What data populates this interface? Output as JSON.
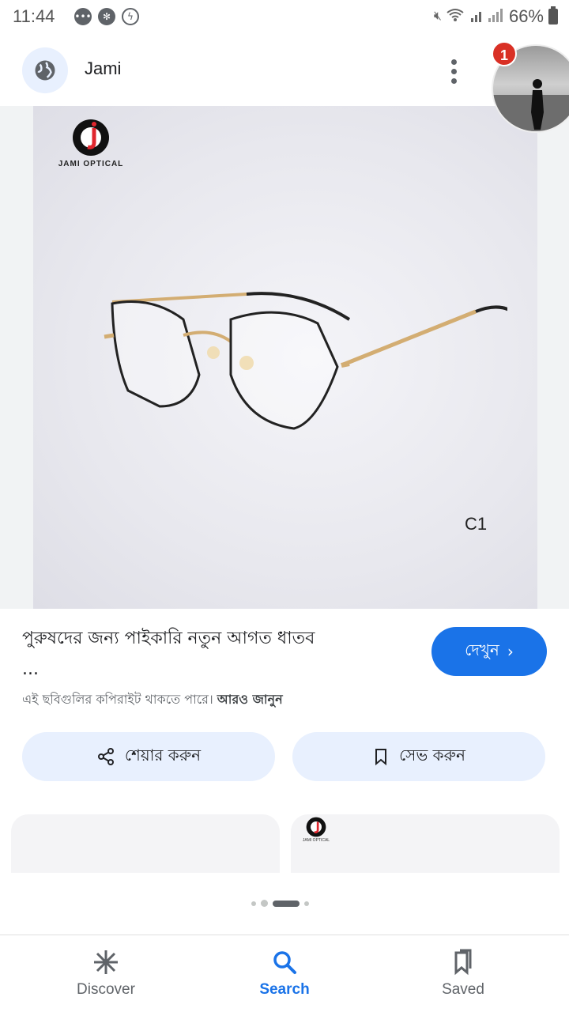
{
  "status_bar": {
    "time": "11:44",
    "battery": "66%",
    "notification_icons": [
      "chat-icon",
      "aperture-icon",
      "messenger-icon"
    ]
  },
  "header": {
    "source_name": "Jami",
    "notification_count": "1"
  },
  "image": {
    "brand_text": "JAMI OPTICAL",
    "variant_code": "C1"
  },
  "result": {
    "title": "পুরুষদের জন্য পাইকারি নতুন আগত ধাতব",
    "ellipsis": "...",
    "visit_label": "দেখুন",
    "copyright_text": "এই ছবিগুলির কপিরাইট থাকতে পারে।",
    "learn_more": "আরও জানুন"
  },
  "actions": {
    "share_label": "শেয়ার করুন",
    "save_label": "সেভ করুন"
  },
  "related": {
    "card2_brand": "JAMI OPTICAL"
  },
  "bottom_nav": [
    {
      "label": "Discover",
      "icon": "asterisk-icon"
    },
    {
      "label": "Search",
      "icon": "search-icon",
      "active": true
    },
    {
      "label": "Saved",
      "icon": "bookmark-icon"
    }
  ],
  "colors": {
    "accent": "#1a73e8",
    "chip_bg": "#e8f0fe",
    "badge": "#d93025"
  }
}
